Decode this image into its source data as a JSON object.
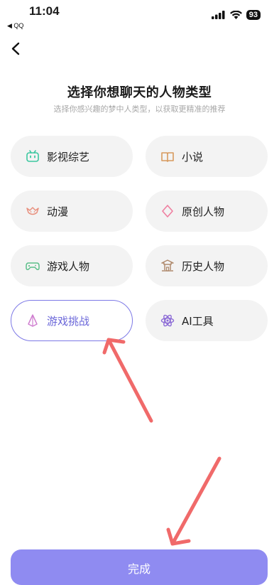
{
  "status_bar": {
    "time": "11:04",
    "back_app": "◀ QQ",
    "battery": "93"
  },
  "header": {
    "title": "选择你想聊天的人物类型",
    "subtitle": "选择你感兴趣的梦中人类型，以获取更精准的推荐"
  },
  "categories": [
    {
      "label": "影视综艺",
      "icon": "tv-icon",
      "selected": false
    },
    {
      "label": "小说",
      "icon": "book-icon",
      "selected": false
    },
    {
      "label": "动漫",
      "icon": "anime-icon",
      "selected": false
    },
    {
      "label": "原创人物",
      "icon": "diamond-icon",
      "selected": false
    },
    {
      "label": "游戏人物",
      "icon": "gamepad-icon",
      "selected": false
    },
    {
      "label": "历史人物",
      "icon": "temple-icon",
      "selected": false
    },
    {
      "label": "游戏挑战",
      "icon": "crystal-icon",
      "selected": true
    },
    {
      "label": "AI工具",
      "icon": "atom-icon",
      "selected": false
    }
  ],
  "footer": {
    "done_label": "完成"
  },
  "colors": {
    "accent": "#8f8bf1",
    "selected_border": "#7d79e6",
    "annotation_arrow": "#f06a6a"
  }
}
